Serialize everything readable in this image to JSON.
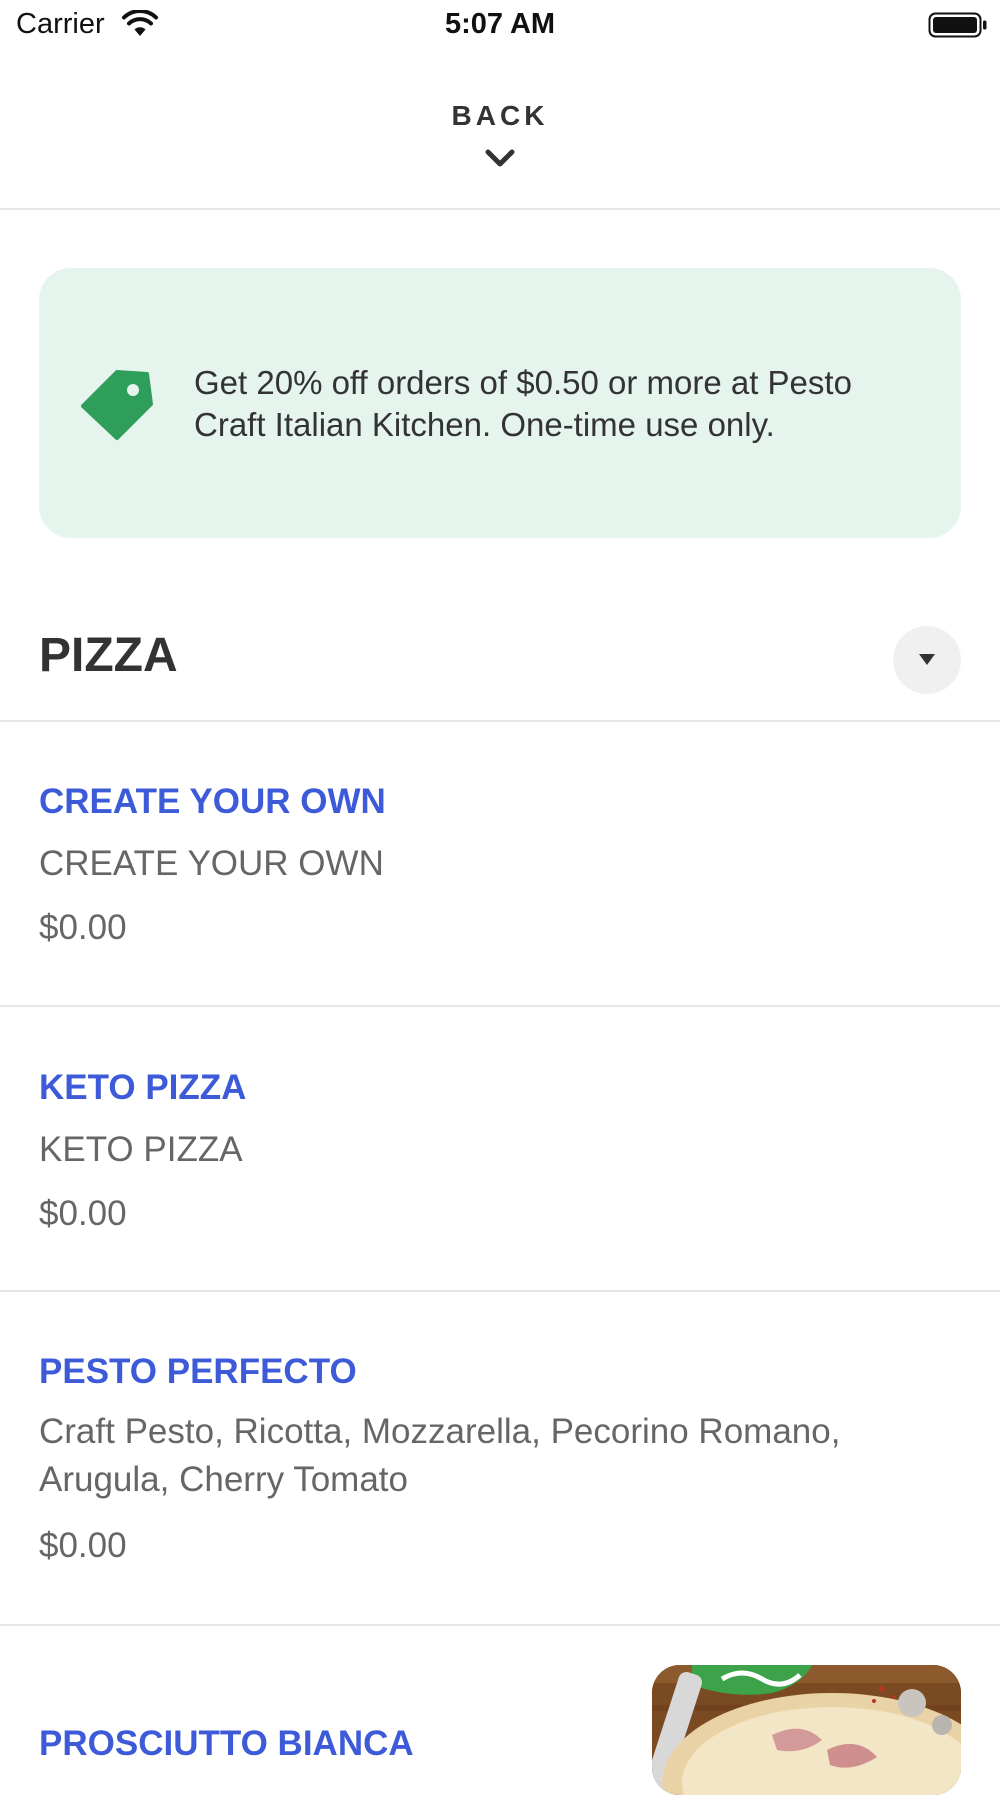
{
  "status_bar": {
    "carrier": "Carrier",
    "time": "5:07 AM"
  },
  "header": {
    "back_label": "BACK"
  },
  "promo": {
    "text": "Get 20% off orders of $0.50 or more at Pesto Craft Italian Kitchen. One-time use only.",
    "accent_color": "#2f9e5a",
    "background_color": "#e5f4ec"
  },
  "section": {
    "title": "PIZZA"
  },
  "menu_items": [
    {
      "name": "CREATE YOUR OWN",
      "description": "CREATE YOUR OWN",
      "price": "$0.00"
    },
    {
      "name": "KETO PIZZA",
      "description": "KETO PIZZA",
      "price": "$0.00"
    },
    {
      "name": "PESTO PERFECTO",
      "description": "Craft Pesto, Ricotta, Mozzarella, Pecorino Romano, Arugula, Cherry Tomato",
      "price": "$0.00"
    },
    {
      "name": "PROSCIUTTO BIANCA"
    }
  ],
  "colors": {
    "item_name": "#3d5bd9",
    "text_secondary": "#666666"
  }
}
